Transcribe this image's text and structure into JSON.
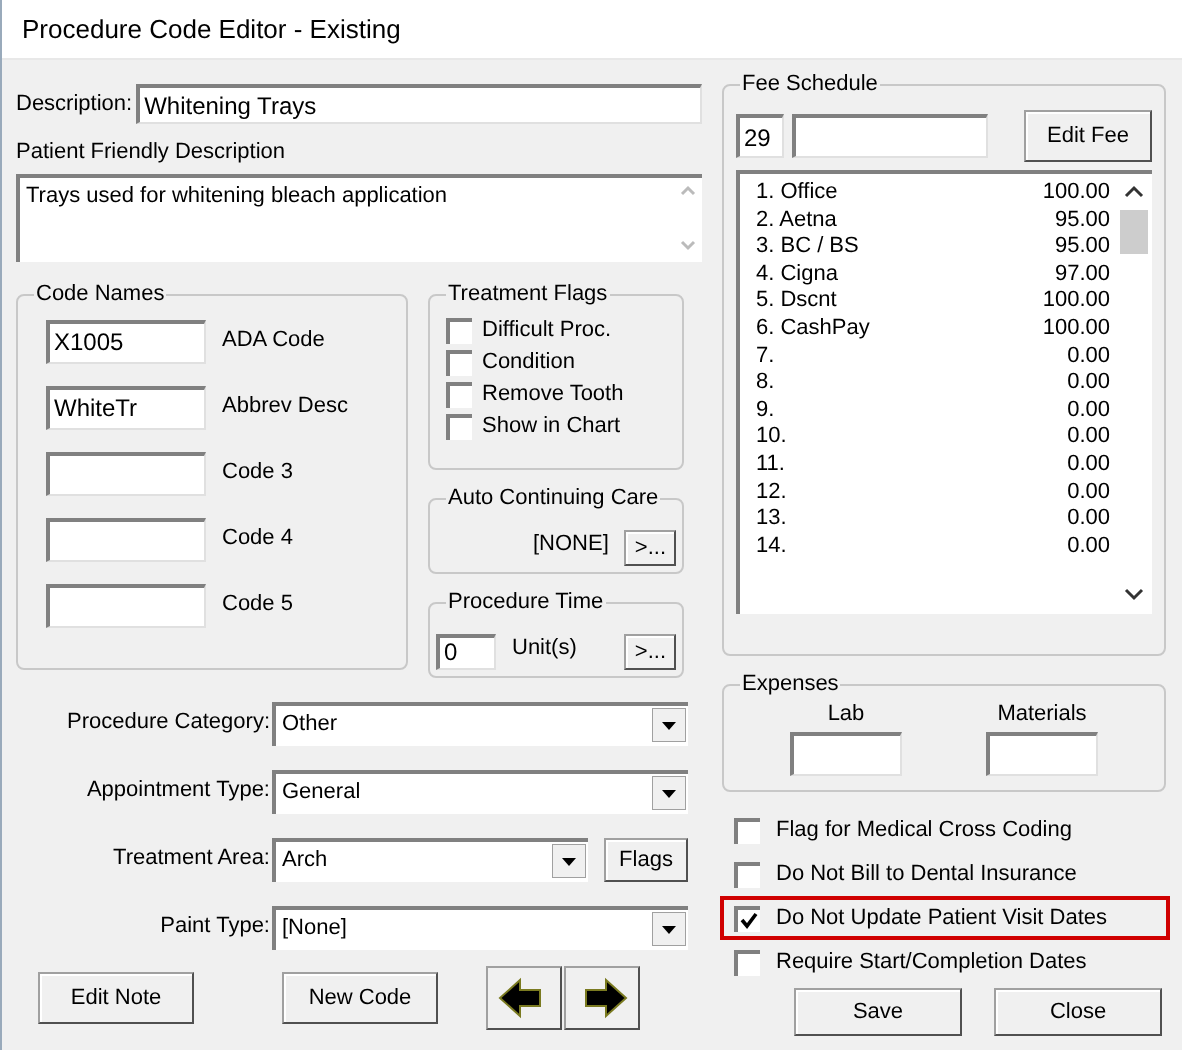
{
  "window": {
    "title": "Procedure Code Editor - Existing"
  },
  "description": {
    "label": "Description:",
    "value": "Whitening Trays"
  },
  "patient_description": {
    "label": "Patient Friendly Description",
    "value": "Trays used for whitening bleach application"
  },
  "code_names": {
    "title": "Code Names",
    "fields": [
      {
        "value": "X1005",
        "label": "ADA Code"
      },
      {
        "value": "WhiteTr",
        "label": "Abbrev Desc"
      },
      {
        "label": "Code 3"
      },
      {
        "label": "Code 4"
      },
      {
        "label": "Code 5"
      }
    ]
  },
  "treatment_flags": {
    "title": "Treatment Flags",
    "items": [
      {
        "label": "Difficult Proc.",
        "checked": false
      },
      {
        "label": "Condition",
        "checked": false
      },
      {
        "label": "Remove Tooth",
        "checked": false
      },
      {
        "label": "Show in Chart",
        "checked": false
      }
    ]
  },
  "auto_continuing_care": {
    "title": "Auto Continuing Care",
    "value": "[NONE]",
    "button": ">..."
  },
  "procedure_time": {
    "title": "Procedure Time",
    "value": "0",
    "unit": "Unit(s)",
    "button": ">..."
  },
  "dropdowns": [
    {
      "label": "Procedure Category:",
      "value": "Other"
    },
    {
      "label": "Appointment Type:",
      "value": "General"
    },
    {
      "label": "Treatment Area:",
      "value": "Arch",
      "button": "Flags"
    },
    {
      "label": "Paint Type:",
      "value": "[None]"
    }
  ],
  "bottom_buttons": [
    {
      "kind": "text",
      "label": "Edit Note"
    },
    {
      "kind": "text",
      "label": "New Code"
    },
    {
      "kind": "prev"
    },
    {
      "kind": "next"
    }
  ],
  "fee_schedule": {
    "title": "Fee Schedule",
    "number": "29",
    "button": "Edit Fee",
    "rows": [
      {
        "label": "1. Office",
        "amount": "100.00"
      },
      {
        "label": "2. Aetna",
        "amount": "95.00"
      },
      {
        "label": "3. BC / BS",
        "amount": "95.00"
      },
      {
        "label": "4. Cigna",
        "amount": "97.00"
      },
      {
        "label": "5. Dscnt",
        "amount": "100.00"
      },
      {
        "label": "6. CashPay",
        "amount": "100.00"
      },
      {
        "label": "7.",
        "amount": "0.00"
      },
      {
        "label": "8.",
        "amount": "0.00"
      },
      {
        "label": "9.",
        "amount": "0.00"
      },
      {
        "label": "10.",
        "amount": "0.00"
      },
      {
        "label": "11.",
        "amount": "0.00"
      },
      {
        "label": "12.",
        "amount": "0.00"
      },
      {
        "label": "13.",
        "amount": "0.00"
      },
      {
        "label": "14.",
        "amount": "0.00"
      }
    ]
  },
  "expenses": {
    "title": "Expenses",
    "fields": [
      {
        "label": "Lab"
      },
      {
        "label": "Materials"
      }
    ]
  },
  "options": [
    {
      "label": "Flag for Medical Cross Coding",
      "checked": false,
      "highlighted": false
    },
    {
      "label": "Do Not Bill to Dental Insurance",
      "checked": false,
      "highlighted": false
    },
    {
      "label": "Do Not Update Patient Visit Dates",
      "checked": true,
      "highlighted": true
    },
    {
      "label": "Require Start/Completion Dates",
      "checked": false,
      "highlighted": false
    }
  ],
  "actions": [
    "Save",
    "Close"
  ]
}
